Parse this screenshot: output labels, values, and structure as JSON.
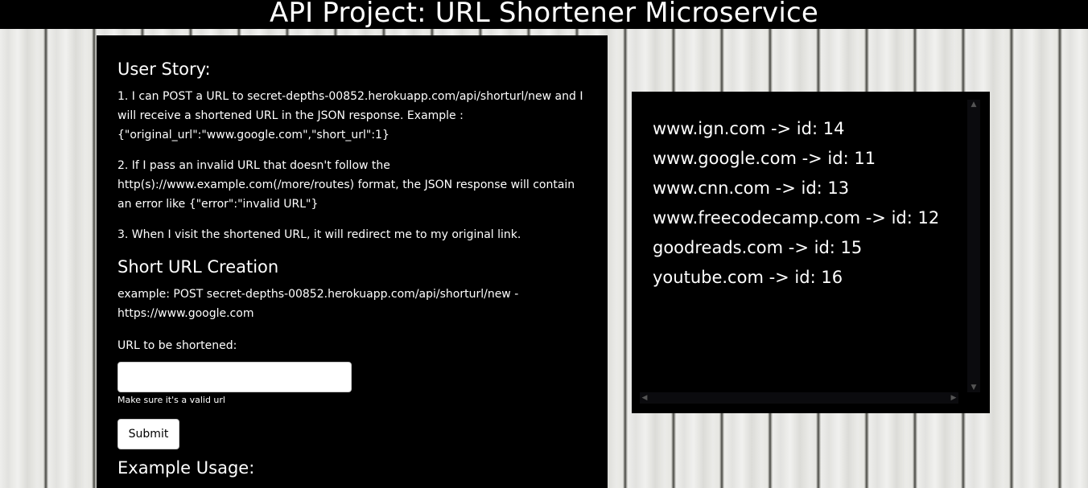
{
  "header": {
    "title": "API Project: URL Shortener Microservice"
  },
  "user_story": {
    "title": "User Story:",
    "items": [
      "1. I can POST a URL to secret-depths-00852.herokuapp.com/api/shorturl/new and I will receive a shortened URL in the JSON response. Example : {\"original_url\":\"www.google.com\",\"short_url\":1}",
      "2. If I pass an invalid URL that doesn't follow the http(s)://www.example.com(/more/routes) format, the JSON response will contain an error like {\"error\":\"invalid URL\"}",
      "3. When I visit the shortened URL, it will redirect me to my original link."
    ]
  },
  "creation": {
    "title": "Short URL Creation",
    "example": "example: POST secret-depths-00852.herokuapp.com/api/shorturl/new - https://www.google.com",
    "label": "URL to be shortened:",
    "input_value": "",
    "input_placeholder": "",
    "hint": "Make sure it's a valid url",
    "submit_label": "Submit"
  },
  "usage": {
    "title": "Example Usage:"
  },
  "url_list": {
    "items": [
      "www.ign.com -> id: 14",
      "www.google.com -> id: 11",
      "www.cnn.com -> id: 13",
      "www.freecodecamp.com -> id: 12",
      "goodreads.com -> id: 15",
      "youtube.com -> id: 16"
    ]
  },
  "colors": {
    "panel_bg": "#000000",
    "text": "#ffffff",
    "button_bg": "#ffffff"
  }
}
